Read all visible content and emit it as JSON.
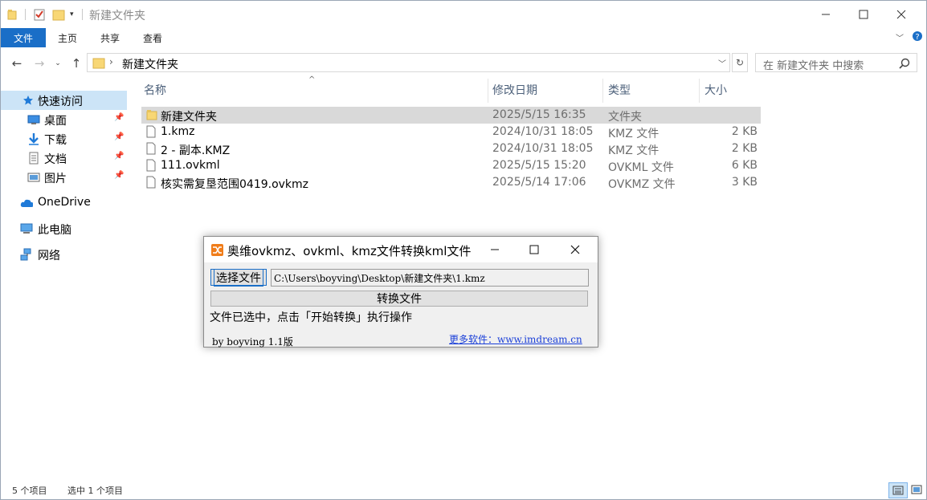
{
  "window": {
    "title": "新建文件夹",
    "controls": [
      "minimize",
      "maximize",
      "close"
    ]
  },
  "ribbon": {
    "tabs": [
      "文件",
      "主页",
      "共享",
      "查看"
    ],
    "active_tab": "文件"
  },
  "address_bar": {
    "breadcrumb": "新建文件夹",
    "search_placeholder": "在 新建文件夹 中搜索"
  },
  "nav_pane": {
    "quick_access": "快速访问",
    "pinned": [
      "桌面",
      "下载",
      "文档",
      "图片"
    ],
    "onedrive": "OneDrive",
    "this_pc": "此电脑",
    "network": "网络"
  },
  "file_list": {
    "columns": [
      "名称",
      "修改日期",
      "类型",
      "大小"
    ],
    "rows": [
      {
        "name": "新建文件夹",
        "date": "2025/5/15 16:35",
        "type": "文件夹",
        "size": "",
        "icon": "folder-icon",
        "selected": true
      },
      {
        "name": "1.kmz",
        "date": "2024/10/31 18:05",
        "type": "KMZ 文件",
        "size": "2 KB",
        "icon": "file-icon",
        "selected": false
      },
      {
        "name": "2 - 副本.KMZ",
        "date": "2024/10/31 18:05",
        "type": "KMZ 文件",
        "size": "2 KB",
        "icon": "file-icon",
        "selected": false
      },
      {
        "name": "111.ovkml",
        "date": "2025/5/15 15:20",
        "type": "OVKML 文件",
        "size": "6 KB",
        "icon": "file-icon",
        "selected": false
      },
      {
        "name": "核实需复垦范围0419.ovkmz",
        "date": "2025/5/14 17:06",
        "type": "OVKMZ 文件",
        "size": "3 KB",
        "icon": "file-icon",
        "selected": false
      }
    ]
  },
  "status_bar": {
    "item_count": "5 个项目",
    "selected_count": "选中 1 个项目"
  },
  "dialog": {
    "title": "奥维ovkmz、ovkml、kmz文件转换kml文件",
    "pick_button": "选择文件",
    "path": "C:\\Users\\boyving\\Desktop\\新建文件夹\\1.kmz",
    "convert_button": "转换文件",
    "message": "文件已选中，点击「开始转换」执行操作",
    "version": "by boyving 1.1版",
    "link": "更多软件：www.imdream.cn"
  },
  "colors": {
    "accent": "#1a6ec7",
    "selection": "#cce4f7",
    "row_selected": "#d9d9d9",
    "folder": "#f8d775",
    "link": "#1a3fd8"
  }
}
